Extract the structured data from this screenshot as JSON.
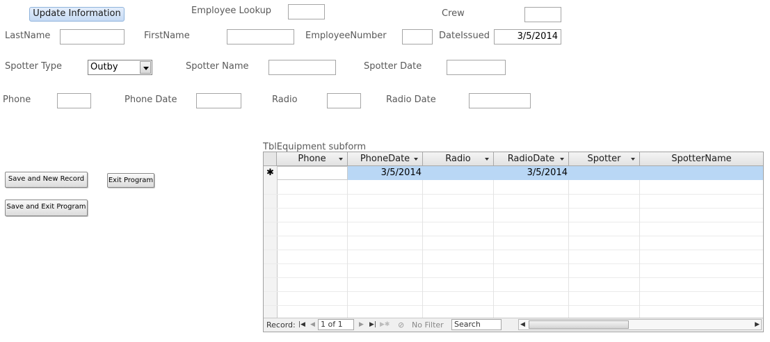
{
  "header": {
    "update_button": "Update Information",
    "employee_lookup_label": "Employee Lookup",
    "crew_label": "Crew"
  },
  "fields": {
    "lastname_label": "LastName",
    "firstname_label": "FirstName",
    "employeenumber_label": "EmployeeNumber",
    "dateissued_label": "DateIssued",
    "dateissued_value": "3/5/2014",
    "spotter_type_label": "Spotter Type",
    "spotter_type_value": "Outby",
    "spotter_name_label": "Spotter Name",
    "spotter_date_label": "Spotter Date",
    "phone_label": "Phone",
    "phone_date_label": "Phone Date",
    "radio_label": "Radio",
    "radio_date_label": "Radio Date"
  },
  "buttons": {
    "save_new": "Save and New Record",
    "exit": "Exit Program",
    "save_exit": "Save and Exit Program"
  },
  "subform": {
    "title": "TblEquipment subform",
    "columns": [
      "Phone",
      "PhoneDate",
      "Radio",
      "RadioDate",
      "Spotter",
      "SpotterName"
    ],
    "new_row": {
      "marker": "✱",
      "phone": "",
      "phonedate": "3/5/2014",
      "radio": "",
      "radiodate": "3/5/2014",
      "spotter": "",
      "spottername": ""
    },
    "nav": {
      "record_label": "Record:",
      "position": "1 of 1",
      "no_filter": "No Filter",
      "search_placeholder": "Search"
    }
  },
  "colors": {
    "label_text": "#595959",
    "selection_row": "#b9d7f5",
    "header_bg": "#e8e8e8"
  }
}
